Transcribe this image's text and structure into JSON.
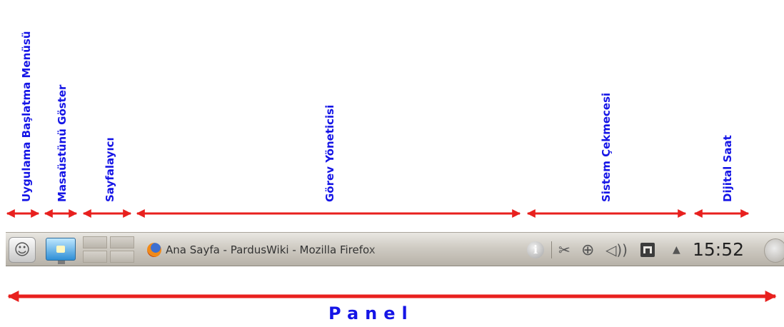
{
  "labels": {
    "app_menu": "Uygulama Başlatma Menüsü",
    "show_desktop": "Masaüstünü Göster",
    "pager": "Sayfalayıcı",
    "task_manager": "Görev Yöneticisi",
    "system_tray": "Sistem Çekmecesi",
    "digital_clock": "Dijital Saat",
    "panel": "Panel"
  },
  "panel": {
    "task_title": "Ana Sayfa - PardusWiki - Mozilla Firefox",
    "clock": "15:52",
    "tray_icons": [
      "info-icon",
      "scissors-icon",
      "usb-icon",
      "volume-icon",
      "network-icon",
      "tray-expand-icon"
    ]
  },
  "colors": {
    "label_blue": "#1515e6",
    "arrow_red": "#e8201e"
  }
}
